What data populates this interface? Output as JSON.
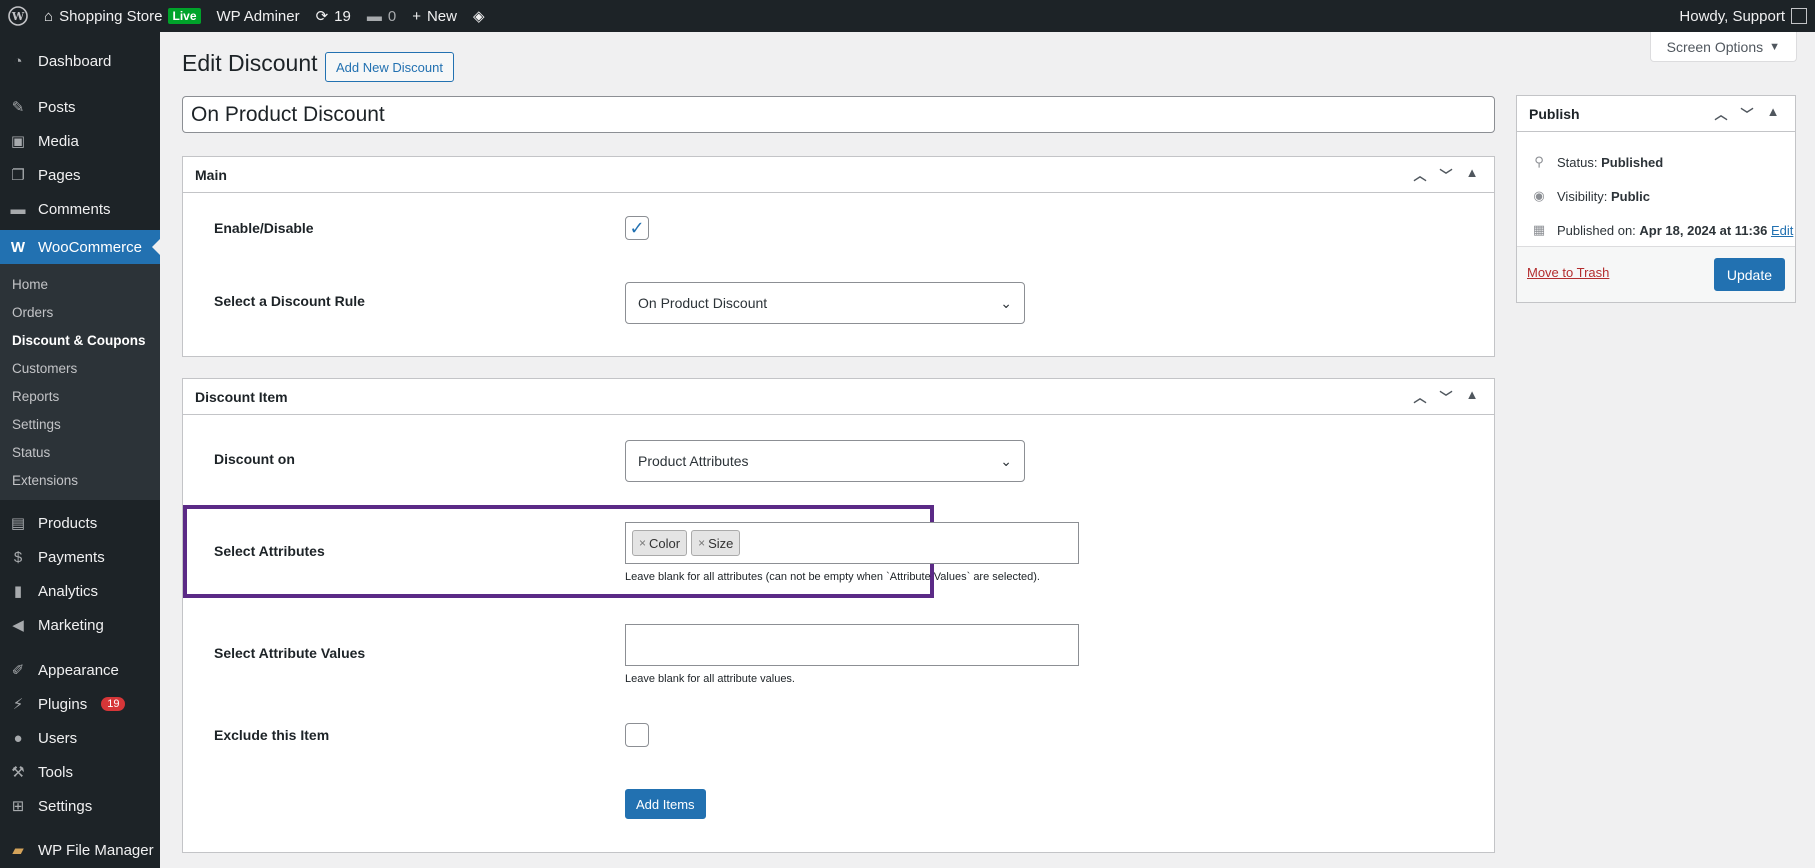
{
  "adminbar": {
    "site_name": "Shopping Store",
    "live_badge": "Live",
    "admin_name": "WP Adminer",
    "updates_count": "19",
    "comments_count": "0",
    "new_label": "New",
    "howdy": "Howdy, Support"
  },
  "sidebar": {
    "items_top": [
      {
        "label": "Dashboard",
        "icon": "dashboard-icon"
      },
      {
        "label": "Posts",
        "icon": "pin-icon"
      },
      {
        "label": "Media",
        "icon": "media-icon"
      },
      {
        "label": "Pages",
        "icon": "pages-icon"
      },
      {
        "label": "Comments",
        "icon": "comments-icon"
      }
    ],
    "woocommerce": "WooCommerce",
    "submenu": [
      "Home",
      "Orders",
      "Discount & Coupons",
      "Customers",
      "Reports",
      "Settings",
      "Status",
      "Extensions"
    ],
    "items_bottom": [
      {
        "label": "Products",
        "icon": "products-icon"
      },
      {
        "label": "Payments",
        "icon": "payments-icon"
      },
      {
        "label": "Analytics",
        "icon": "analytics-icon"
      },
      {
        "label": "Marketing",
        "icon": "marketing-icon"
      },
      {
        "label": "Appearance",
        "icon": "appearance-icon"
      },
      {
        "label": "Plugins",
        "icon": "plugins-icon",
        "badge": "19"
      },
      {
        "label": "Users",
        "icon": "users-icon"
      },
      {
        "label": "Tools",
        "icon": "tools-icon"
      },
      {
        "label": "Settings",
        "icon": "settings-icon"
      },
      {
        "label": "WP File Manager",
        "icon": "folder-icon"
      }
    ]
  },
  "main": {
    "screen_options": "Screen Options",
    "page_title": "Edit Discount",
    "add_new": "Add New Discount",
    "post_title": "On Product Discount",
    "main_box": {
      "title": "Main",
      "enable_label": "Enable/Disable",
      "enable_checked": true,
      "rule_label": "Select a Discount Rule",
      "rule_value": "On Product Discount"
    },
    "item_box": {
      "title": "Discount Item",
      "discount_on_label": "Discount on",
      "discount_on_value": "Product Attributes",
      "attributes_label": "Select Attributes",
      "attributes": [
        "Color",
        "Size"
      ],
      "attributes_hint": "Leave blank for all attributes (can not be empty when `Attribute Values` are selected).",
      "values_label": "Select Attribute Values",
      "values_hint": "Leave blank for all attribute values.",
      "exclude_label": "Exclude this Item",
      "add_items": "Add Items"
    }
  },
  "publish": {
    "title": "Publish",
    "status_label": "Status:",
    "status_value": "Published",
    "visibility_label": "Visibility:",
    "visibility_value": "Public",
    "published_label": "Published on:",
    "published_value": "Apr 18, 2024 at 11:36",
    "edit_link": "Edit",
    "trash": "Move to Trash",
    "update": "Update"
  },
  "colors": {
    "accent": "#2271b1",
    "admin_dark": "#1d2327",
    "highlight": "#5b2a86",
    "live_green": "#00a32a",
    "badge_red": "#d63638"
  }
}
